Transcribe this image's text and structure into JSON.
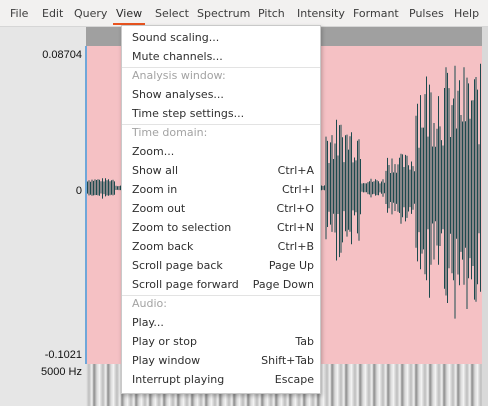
{
  "menubar": {
    "items": [
      "File",
      "Edit",
      "Query",
      "View",
      "Select",
      "Spectrum",
      "Pitch",
      "Intensity",
      "Formant",
      "Pulses",
      "Help"
    ],
    "active": "View"
  },
  "colors": {
    "accent": "#e95420",
    "selection": "#f5c1c4",
    "waveform": "#1d4a4e",
    "cursor_line": "#6fa7d9"
  },
  "axis": {
    "top_value": "0.08704",
    "zero_value": "0",
    "bottom_value": "-0.1021",
    "spectrogram_top": "5000 Hz"
  },
  "view_menu": {
    "items": [
      {
        "label": "Sound scaling...",
        "shortcut": "",
        "enabled": true
      },
      {
        "label": "Mute channels...",
        "shortcut": "",
        "enabled": true
      },
      {
        "label": "Analysis window:",
        "shortcut": "",
        "enabled": false
      },
      {
        "label": "Show analyses...",
        "shortcut": "",
        "enabled": true
      },
      {
        "label": "Time step settings...",
        "shortcut": "",
        "enabled": true
      },
      {
        "label": "Time domain:",
        "shortcut": "",
        "enabled": false
      },
      {
        "label": "Zoom...",
        "shortcut": "",
        "enabled": true
      },
      {
        "label": "Show all",
        "shortcut": "Ctrl+A",
        "enabled": true
      },
      {
        "label": "Zoom in",
        "shortcut": "Ctrl+I",
        "enabled": true
      },
      {
        "label": "Zoom out",
        "shortcut": "Ctrl+O",
        "enabled": true
      },
      {
        "label": "Zoom to selection",
        "shortcut": "Ctrl+N",
        "enabled": true
      },
      {
        "label": "Zoom back",
        "shortcut": "Ctrl+B",
        "enabled": true
      },
      {
        "label": "Scroll page back",
        "shortcut": "Page Up",
        "enabled": true
      },
      {
        "label": "Scroll page forward",
        "shortcut": "Page Down",
        "enabled": true
      },
      {
        "label": "Audio:",
        "shortcut": "",
        "enabled": false
      },
      {
        "label": "Play...",
        "shortcut": "",
        "enabled": true
      },
      {
        "label": "Play or stop",
        "shortcut": "Tab",
        "enabled": true
      },
      {
        "label": "Play window",
        "shortcut": "Shift+Tab",
        "enabled": true
      },
      {
        "label": "Interrupt playing",
        "shortcut": "Escape",
        "enabled": true
      }
    ]
  }
}
